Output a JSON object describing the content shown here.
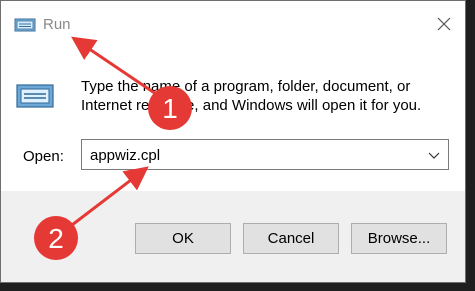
{
  "window": {
    "title": "Run",
    "close_symbol": "×"
  },
  "content": {
    "description": "Type the name of a program, folder, document, or Internet resource, and Windows will open it for you.",
    "open_label": "Open:",
    "open_value": "appwiz.cpl"
  },
  "buttons": {
    "ok": "OK",
    "cancel": "Cancel",
    "browse": "Browse..."
  },
  "annotations": [
    {
      "number": "1",
      "color": "#e53935"
    },
    {
      "number": "2",
      "color": "#e53935"
    }
  ],
  "icons": {
    "title": "run-icon",
    "big": "run-icon-large",
    "close": "close-icon",
    "dropdown": "chevron-down-icon"
  }
}
